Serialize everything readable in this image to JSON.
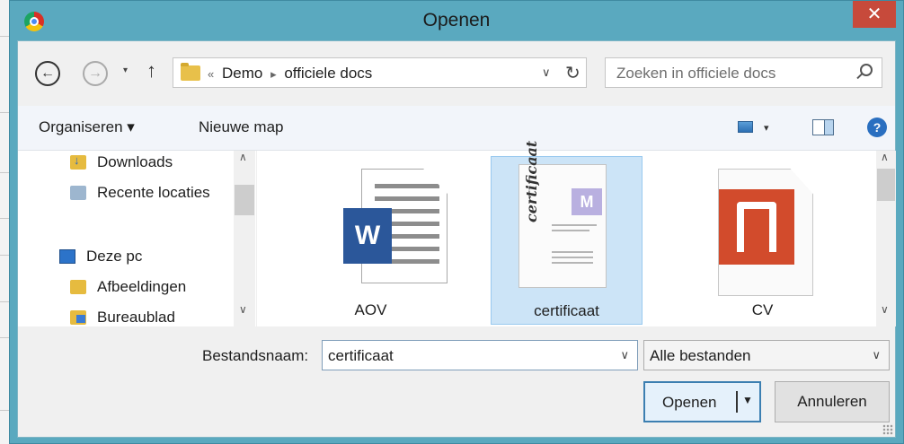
{
  "window": {
    "title": "Openen",
    "close_glyph": "✕",
    "app_icon": "chrome-icon",
    "title_bar_color": "#5aa9bf"
  },
  "navigation": {
    "back_glyph": "←",
    "forward_glyph": "→",
    "history_glyph": "▾",
    "up_glyph": "↑",
    "breadcrumb": [
      "«",
      "Demo",
      "▸",
      "officiele docs"
    ],
    "dropdown_glyph": "∨",
    "refresh_glyph": "↻",
    "search_placeholder": "Zoeken in officiele docs"
  },
  "toolbar": {
    "organize_label": "Organiseren ▾",
    "new_folder_label": "Nieuwe map",
    "view_dropdown_glyph": "▾",
    "help_glyph": "?"
  },
  "nav_pane": {
    "items": [
      {
        "label": "Downloads",
        "icon": "downloads-icon"
      },
      {
        "label": "Recente locaties",
        "icon": "recent-places-icon"
      },
      {
        "label": "Deze pc",
        "icon": "computer-icon"
      },
      {
        "label": "Afbeeldingen",
        "icon": "pictures-folder-icon"
      },
      {
        "label": "Bureaublad",
        "icon": "desktop-folder-icon"
      }
    ],
    "scroll_up_glyph": "∧",
    "scroll_down_glyph": "∨"
  },
  "files": [
    {
      "name": "AOV",
      "icon": "word-document-icon",
      "badge": "W",
      "selected": false
    },
    {
      "name": "certificaat",
      "icon": "certificate-document-icon",
      "selected": true
    },
    {
      "name": "CV",
      "icon": "pdf-document-icon",
      "selected": false
    }
  ],
  "file_scroll": {
    "up_glyph": "∧",
    "down_glyph": "∨"
  },
  "bottom": {
    "filename_label": "Bestandsnaam:",
    "filename_value": "certificaat",
    "filename_chevron": "∨",
    "filetype_value": "Alle bestanden",
    "filetype_chevron": "∨",
    "open_label": "Openen",
    "open_arrow": "▼",
    "cancel_label": "Annuleren"
  },
  "colors": {
    "selection": "#cce4f7",
    "close_button": "#c74a3b",
    "word_blue": "#2b579a",
    "pdf_red": "#d24b2c"
  }
}
